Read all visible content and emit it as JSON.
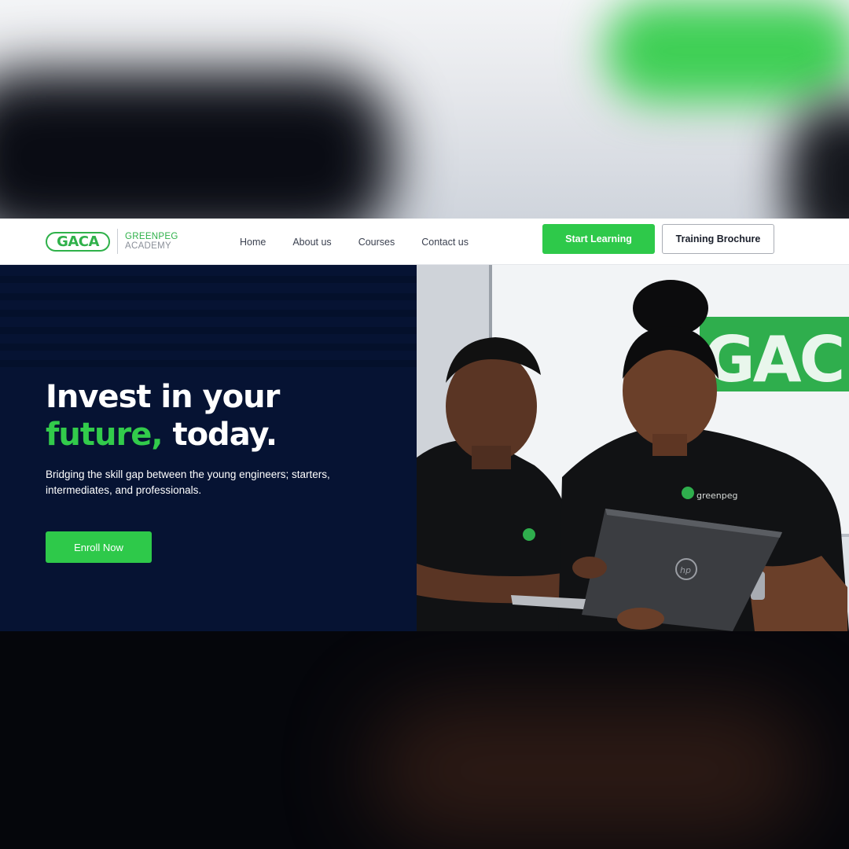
{
  "logo": {
    "mark": "GACA",
    "line1": "GREENPEG",
    "line2": "ACADEMY"
  },
  "nav": {
    "items": [
      "Home",
      "About us",
      "Courses",
      "Contact us"
    ]
  },
  "cta": {
    "start": "Start Learning",
    "brochure": "Training Brochure"
  },
  "hero": {
    "title_line1": "Invest in your",
    "title_green": "future,",
    "title_rest": " today.",
    "subtitle": "Bridging the skill gap between the young engineers; starters, intermediates, and professionals.",
    "enroll": "Enroll Now"
  },
  "photo": {
    "wall_sign": "GAC",
    "shirt_logo": "greenpeg"
  },
  "colors": {
    "accent": "#2ec94a",
    "navy": "#061333",
    "text_dark": "#3b4150"
  }
}
